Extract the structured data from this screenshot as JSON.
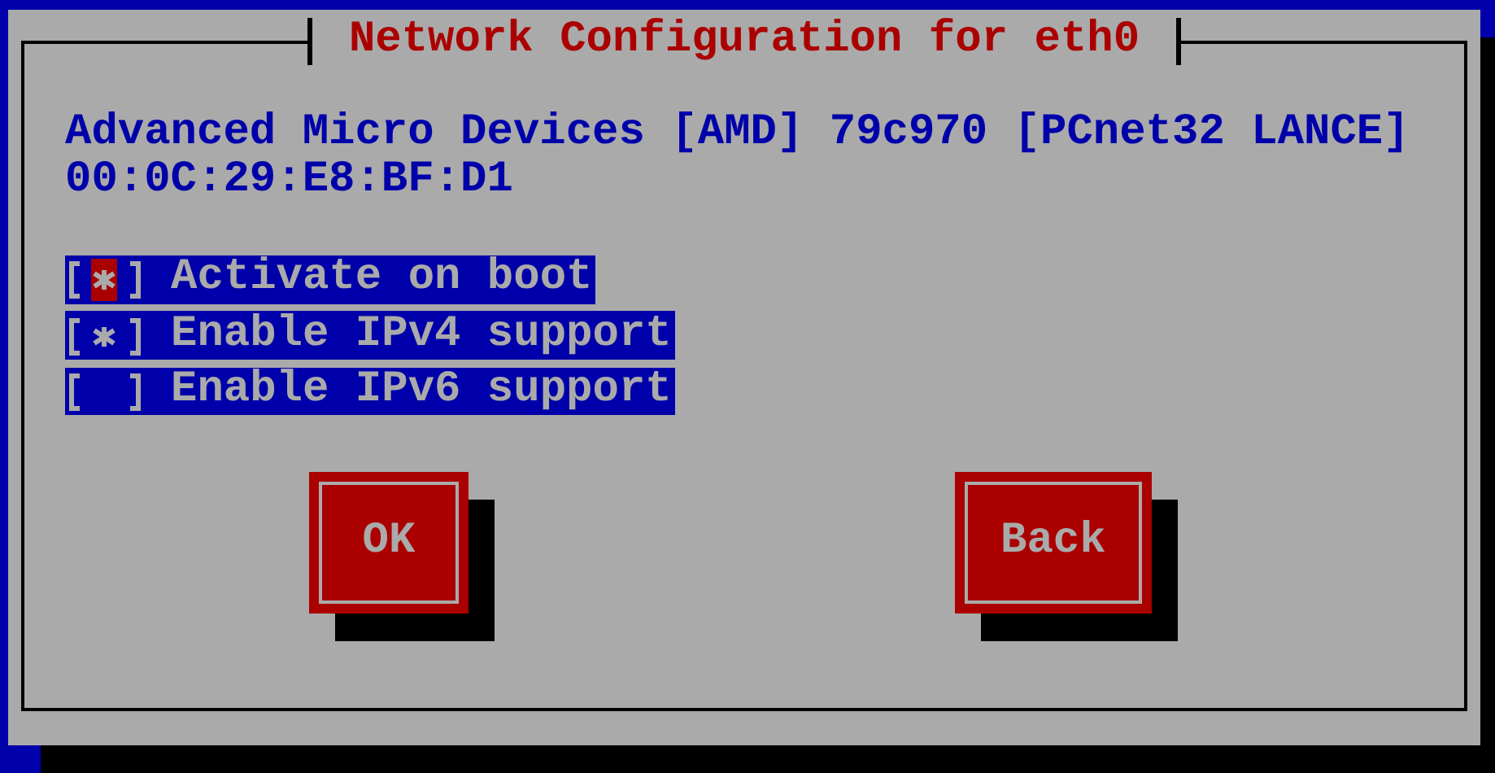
{
  "window": {
    "title": "Network Configuration for eth0"
  },
  "device": {
    "name": "Advanced Micro Devices [AMD] 79c970 [PCnet32 LANCE]",
    "mac": "00:0C:29:E8:BF:D1"
  },
  "options": [
    {
      "label": "Activate on boot",
      "checked": true,
      "focused": true
    },
    {
      "label": "Enable IPv4 support",
      "checked": true,
      "focused": false
    },
    {
      "label": "Enable IPv6 support",
      "checked": false,
      "focused": false
    }
  ],
  "buttons": [
    {
      "label": "OK"
    },
    {
      "label": "Back"
    }
  ]
}
